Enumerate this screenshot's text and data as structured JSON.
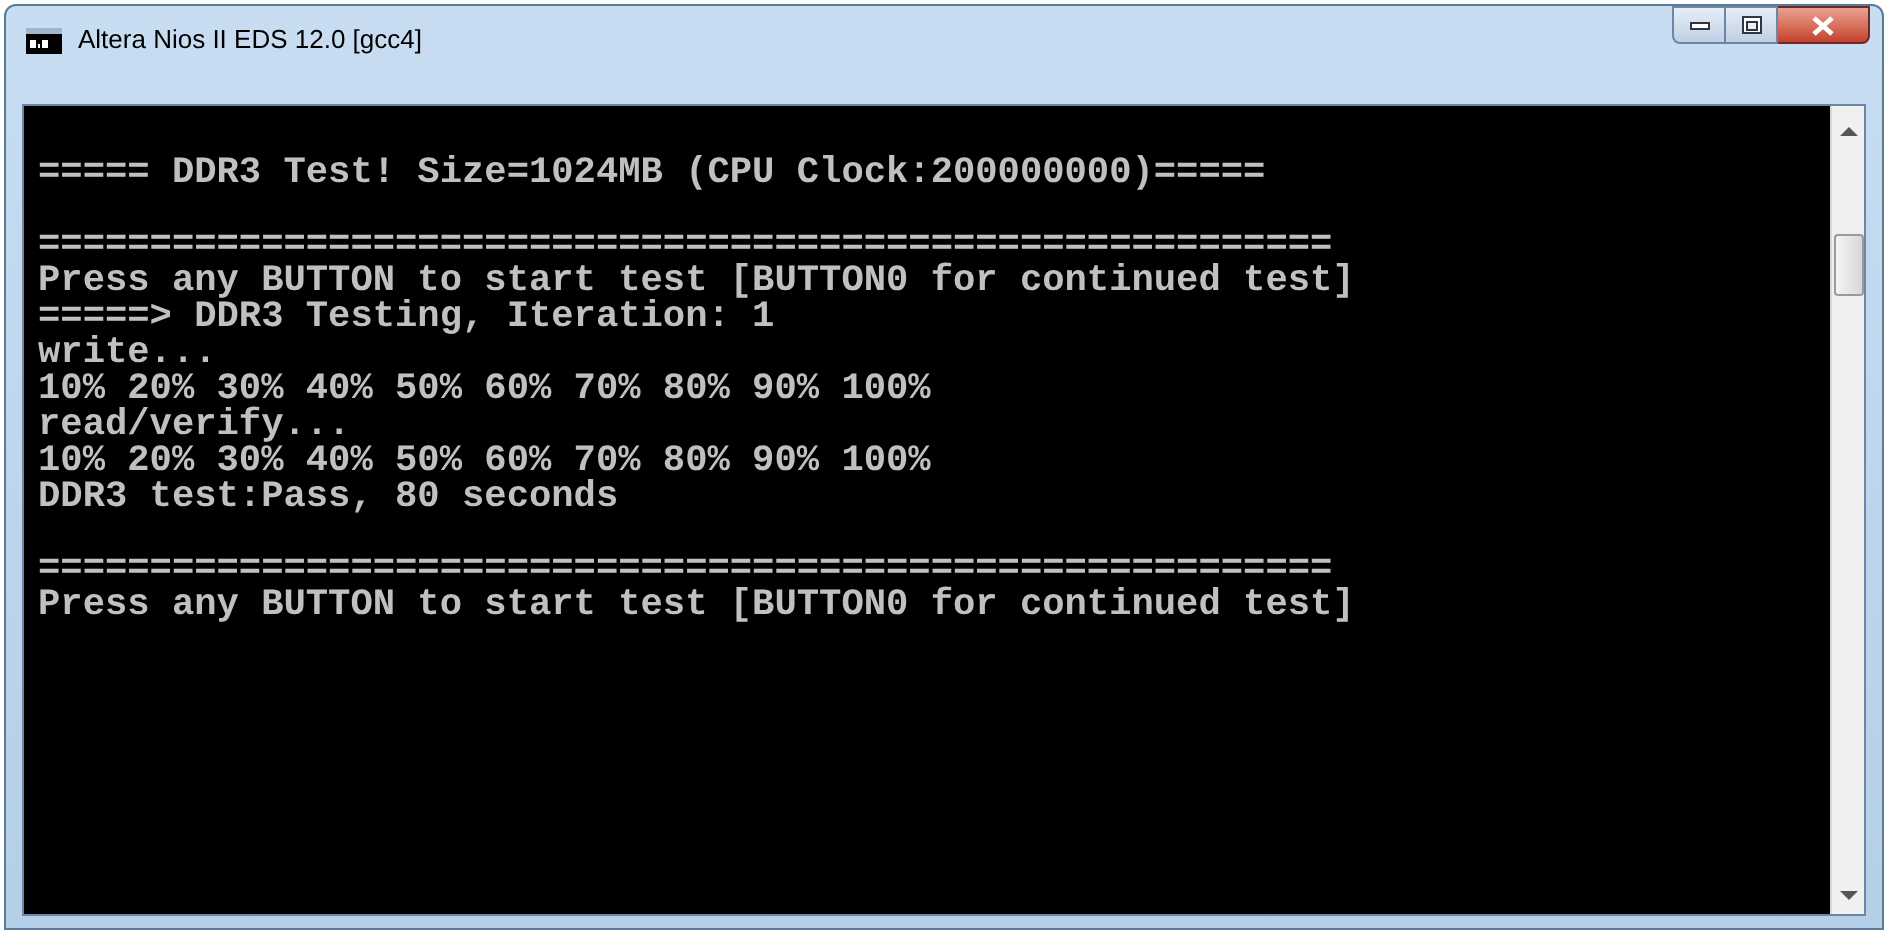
{
  "window": {
    "title": "Altera Nios II EDS 12.0 [gcc4]"
  },
  "console": {
    "blocks": [
      [
        "===== DDR3 Test! Size=1024MB (CPU Clock:200000000)====="
      ],
      [
        "==========================================================",
        "Press any BUTTON to start test [BUTTON0 for continued test]",
        "=====> DDR3 Testing, Iteration: 1",
        "write...",
        "10% 20% 30% 40% 50% 60% 70% 80% 90% 100%",
        "read/verify...",
        "10% 20% 30% 40% 50% 60% 70% 80% 90% 100%",
        "DDR3 test:Pass, 80 seconds"
      ],
      [
        "==========================================================",
        "Press any BUTTON to start test [BUTTON0 for continued test]"
      ]
    ]
  }
}
